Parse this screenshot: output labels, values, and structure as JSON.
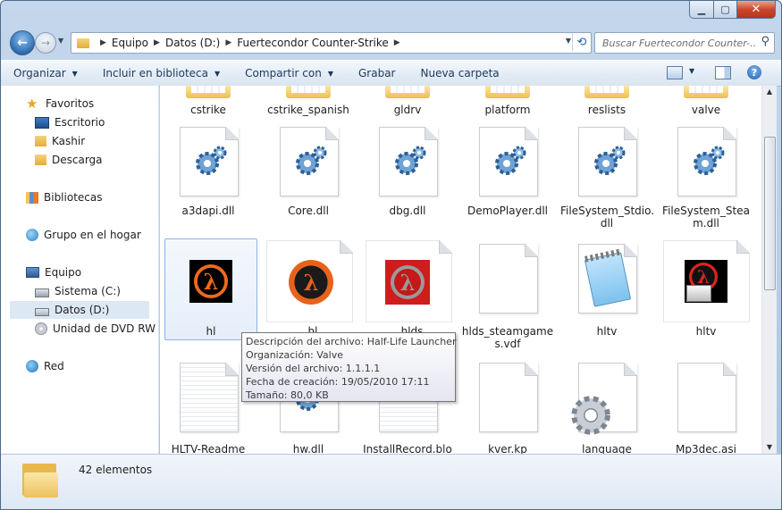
{
  "window": {
    "controls": {
      "minimize": "▁",
      "maximize": "▢",
      "close": "✕"
    }
  },
  "nav": {
    "back_icon": "back-arrow-icon",
    "breadcrumb": [
      "Equipo",
      "Datos (D:)",
      "Fuertecondor Counter-Strike"
    ],
    "search_placeholder": "Buscar Fuertecondor Counter-..."
  },
  "toolbar": {
    "items": [
      {
        "label": "Organizar",
        "dropdown": true
      },
      {
        "label": "Incluir en biblioteca",
        "dropdown": true
      },
      {
        "label": "Compartir con",
        "dropdown": true
      },
      {
        "label": "Grabar",
        "dropdown": false
      },
      {
        "label": "Nueva carpeta",
        "dropdown": false
      }
    ],
    "help": "?"
  },
  "sidebar": {
    "favorites": {
      "label": "Favoritos",
      "items": [
        "Escritorio",
        "Kashir",
        "Descarga"
      ]
    },
    "libraries": "Bibliotecas",
    "homegroup": "Grupo en el hogar",
    "computer": {
      "label": "Equipo",
      "items": [
        "Sistema (C:)",
        "Datos (D:)",
        "Unidad de DVD RW ("
      ]
    },
    "network": "Red"
  },
  "files": {
    "row0": [
      "cstrike",
      "cstrike_spanish",
      "gldrv",
      "platform",
      "reslists",
      "valve"
    ],
    "row1": [
      "a3dapi.dll",
      "Core.dll",
      "dbg.dll",
      "DemoPlayer.dll",
      "FileSystem_Stdio.\ndll",
      "FileSystem_Stea\nm.dll"
    ],
    "row2": [
      "hl",
      "hl",
      "hlds",
      "hlds_steamgame\ns.vdf",
      "hltv",
      "hltv"
    ],
    "row3": [
      "HLTV-Readme",
      "hw.dll",
      "InstallRecord.blo",
      "kver.kp",
      "language",
      "Mp3dec.asi"
    ]
  },
  "tooltip": [
    "Descripción del archivo: Half-Life Launcher",
    "Organización: Valve",
    "Versión del archivo: 1.1.1.1",
    "Fecha de creación: 19/05/2010 17:11",
    "Tamaño: 80,0 KB"
  ],
  "details": {
    "count": "42 elementos"
  },
  "colors": {
    "accent": "#1f63b5",
    "selection": "#dde8f5",
    "folder": "#e9bf56",
    "hl_orange": "#f06a1c"
  }
}
